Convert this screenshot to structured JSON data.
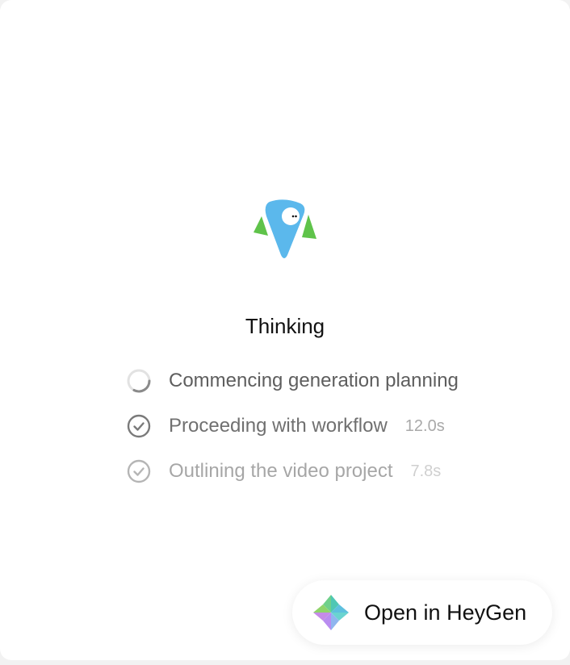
{
  "status": {
    "title": "Thinking"
  },
  "steps": [
    {
      "label": "Commencing generation planning",
      "time": "",
      "state": "in-progress",
      "icon": "spinner-icon"
    },
    {
      "label": "Proceeding with workflow",
      "time": "12.0s",
      "state": "done",
      "icon": "check-circle-icon"
    },
    {
      "label": "Outlining the video project",
      "time": "7.8s",
      "state": "done",
      "icon": "check-circle-icon"
    }
  ],
  "actions": {
    "open_label": "Open in HeyGen"
  },
  "colors": {
    "mascot_blue": "#5bb8ec",
    "mascot_green": "#5fc34a",
    "text_primary": "#111111",
    "text_secondary": "#5e5e5e",
    "text_muted": "#a9a9a9"
  },
  "icons": {
    "mascot": "heygen-mascot-icon",
    "logo": "heygen-logo-icon"
  }
}
